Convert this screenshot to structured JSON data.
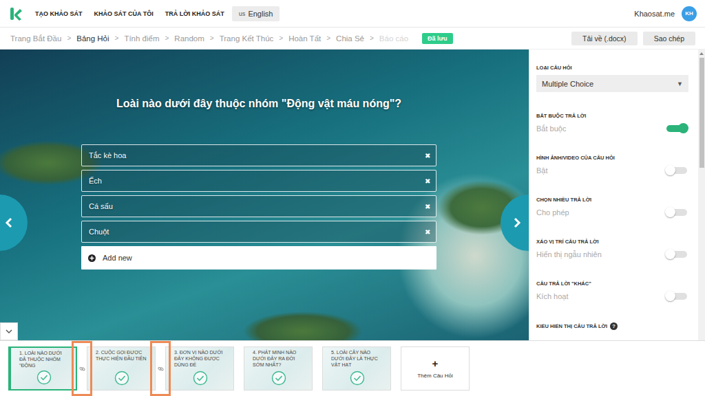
{
  "brand": {
    "name": "Khaosat.me",
    "avatar": "KH"
  },
  "nav": [
    {
      "label": "TẠO KHẢO SÁT"
    },
    {
      "label": "KHẢO SÁT CỦA TÔI"
    },
    {
      "label": "TRẢ LỜI KHẢO SÁT"
    }
  ],
  "language": {
    "flag": "us",
    "label": "English"
  },
  "steps": {
    "separator": ">",
    "items": [
      {
        "label": "Trang Bắt Đầu",
        "selected": false,
        "disabled": false
      },
      {
        "label": "Bảng Hỏi",
        "selected": true,
        "disabled": false
      },
      {
        "label": "Tính điểm",
        "selected": false,
        "disabled": false
      },
      {
        "label": "Random",
        "selected": false,
        "disabled": false
      },
      {
        "label": "Trang Kết Thúc",
        "selected": false,
        "disabled": false
      },
      {
        "label": "Hoàn Tất",
        "selected": false,
        "disabled": false
      },
      {
        "label": "Chia Sẻ",
        "selected": false,
        "disabled": false
      },
      {
        "label": "Báo cáo",
        "selected": false,
        "disabled": true
      }
    ]
  },
  "save_status": "Đã lưu",
  "actions": [
    "Tải về (.docx)",
    "Sao chép"
  ],
  "question": {
    "title": "Loài nào dưới đây thuộc nhóm \"Động vật máu nóng\"?",
    "remove_icon": "✖",
    "answers": [
      "Tắc kè hoa",
      "Ếch",
      "Cá sấu",
      "Chuột"
    ],
    "add_label": "Add new"
  },
  "settings": [
    {
      "kind": "select",
      "label": "LOẠI CÂU HỎI",
      "value": "Multiple Choice",
      "caret": "▼"
    },
    {
      "kind": "toggle",
      "label": "BẮT BUỘC TRẢ LỜI",
      "value": "Bắt buộc",
      "on": true
    },
    {
      "kind": "toggle",
      "label": "HÌNH ẢNH/VIDEO CỦA CÂU HỎI",
      "value": "Bật",
      "on": false
    },
    {
      "kind": "toggle",
      "label": "CHỌN NHIỀU TRẢ LỜI",
      "value": "Cho phép",
      "on": false
    },
    {
      "kind": "toggle",
      "label": "XÁO VỊ TRÍ CÂU TRẢ LỜI",
      "value": "Hiển thị ngẫu nhiên",
      "on": false
    },
    {
      "kind": "toggle",
      "label": "CÂU TRẢ LỜI \"KHÁC\"",
      "value": "Kích hoạt",
      "on": false
    },
    {
      "kind": "heading",
      "label": "KIỂU HIỂN THỊ CÂU TRẢ LỜI",
      "help": "?"
    }
  ],
  "questions": [
    {
      "text": "1. LOÀI NÀO DƯỚI ĐÂ THUỘC NHÓM \"ĐỘNG",
      "selected": true,
      "done": true,
      "linked_to_next": true,
      "highlighted": true
    },
    {
      "text": "2. CUỘC GỌI ĐƯỢC THỰC HIỆN ĐẦU TIÊN",
      "selected": false,
      "done": true,
      "linked_to_next": true,
      "highlighted": true
    },
    {
      "text": "3. ĐƠN VỊ NÀO DƯỚI ĐÂY KHÔNG ĐƯỢC DÙNG ĐỂ",
      "selected": false,
      "done": true,
      "linked_to_next": false,
      "highlighted": false
    },
    {
      "text": "4. PHÁT MINH NÀO DƯỚI ĐÂY RA ĐỜI SỚM NHẤT?",
      "selected": false,
      "done": true,
      "linked_to_next": false,
      "highlighted": false
    },
    {
      "text": "5. LOÀI CÂY NÀO DƯỚI ĐÂY LÀ THỰC VẬT HẠT",
      "selected": false,
      "done": true,
      "linked_to_next": false,
      "highlighted": false
    }
  ],
  "add_question": {
    "icon": "+",
    "label": "Thêm Câu Hỏi"
  }
}
